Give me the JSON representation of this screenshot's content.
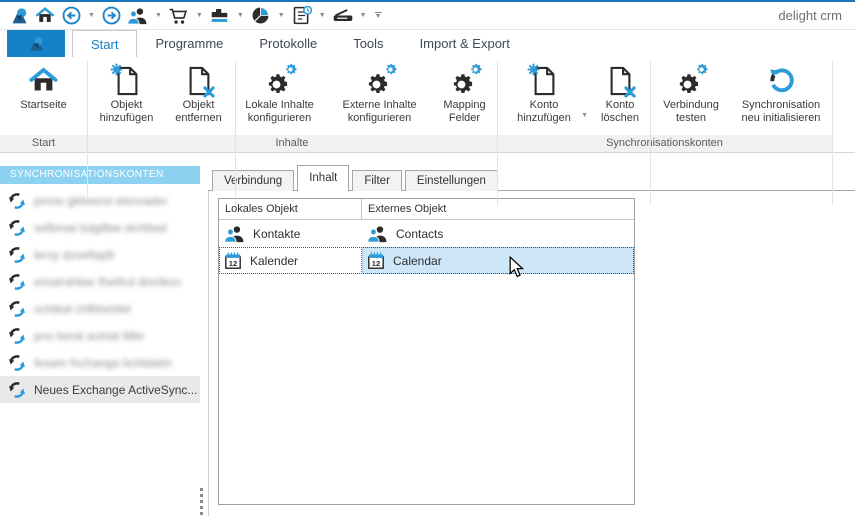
{
  "window": {
    "title": "delight crm"
  },
  "colors": {
    "accent_blue": "#1581c6",
    "icon_blue": "#2e9bd9",
    "icon_dark": "#2b2b2b",
    "titlebar_line": "#1a75bb",
    "sidebar_header_bg": "#8dd2f1",
    "selected_cell_bg": "#cde7f8",
    "selected_sidebar_bg": "#e9e9e9"
  },
  "quick_toolbar": {
    "icons": [
      {
        "name": "app-logo-icon"
      },
      {
        "name": "home-icon"
      },
      {
        "name": "back-icon",
        "dropdown": true
      },
      {
        "name": "forward-icon"
      },
      {
        "name": "contacts-icon",
        "dropdown": true
      },
      {
        "name": "cart-icon",
        "dropdown": true
      },
      {
        "name": "sales-chart-icon",
        "dropdown": true
      },
      {
        "name": "pie-chart-icon",
        "dropdown": true
      },
      {
        "name": "journal-icon",
        "dropdown": true
      },
      {
        "name": "scanner-icon",
        "dropdown": true
      },
      {
        "name": "customize-toolbar-icon"
      }
    ]
  },
  "main_tabs": {
    "items": [
      {
        "label": "Start",
        "active": true
      },
      {
        "label": "Programme",
        "active": false
      },
      {
        "label": "Protokolle",
        "active": false
      },
      {
        "label": "Tools",
        "active": false
      },
      {
        "label": "Import & Export",
        "active": false
      }
    ]
  },
  "ribbon": {
    "groups": [
      "Start",
      "Inhalte",
      "Synchronisationskonten"
    ],
    "buttons": [
      {
        "label": "Startseite",
        "icon": "home-icon",
        "group": "Start"
      },
      {
        "label": "Objekt\nhinzufügen",
        "icon": "document-add-icon",
        "group": "Inhalte"
      },
      {
        "label": "Objekt\nentfernen",
        "icon": "document-remove-icon",
        "group": "Inhalte"
      },
      {
        "label": "Lokale Inhalte\nkonfigurieren",
        "icon": "gears-icon",
        "group": "Inhalte"
      },
      {
        "label": "Externe Inhalte\nkonfigurieren",
        "icon": "gears-icon",
        "group": "Inhalte"
      },
      {
        "label": "Mapping\nFelder",
        "icon": "gears-icon",
        "group": "Inhalte"
      },
      {
        "label": "Konto\nhinzufügen",
        "icon": "document-add-icon",
        "dropdown": true,
        "group": "Synchronisationskonten"
      },
      {
        "label": "Konto\nlöschen",
        "icon": "document-remove-icon",
        "group": "Synchronisationskonten"
      },
      {
        "label": "Verbindung\ntesten",
        "icon": "gears-icon",
        "group": "Synchronisationskonten"
      },
      {
        "label": "Synchronisation\nneu initialisieren",
        "icon": "sync-refresh-icon",
        "group": "Synchronisationskonten"
      }
    ]
  },
  "sidebar": {
    "header": "SYNCHRONISATIONSKONTEN",
    "items": [
      {
        "redacted": true,
        "obscured_text": "pmne gkfwend slenvader",
        "selected": false
      },
      {
        "redacted": true,
        "obscured_text": "sefbmat bdgltbw dnrttlwd",
        "selected": false
      },
      {
        "redacted": true,
        "obscured_text": "lerxy dzseftapfi",
        "selected": false
      },
      {
        "redacted": true,
        "obscured_text": "ematrahber fhetfcd dmrtlion",
        "selected": false
      },
      {
        "redacted": true,
        "obscured_text": "schtkat chfbtsrtdel",
        "selected": false
      },
      {
        "redacted": true,
        "obscured_text": "pns beral actriat fillte",
        "selected": false
      },
      {
        "redacted": true,
        "obscured_text": "fesam fnchanga bchtdatm",
        "selected": false
      },
      {
        "redacted": false,
        "label": "Neues Exchange ActiveSync...",
        "selected": true
      }
    ]
  },
  "panel": {
    "tabs": [
      {
        "label": "Verbindung",
        "active": false
      },
      {
        "label": "Inhalt",
        "active": true
      },
      {
        "label": "Filter",
        "active": false
      },
      {
        "label": "Einstellungen",
        "active": false
      }
    ],
    "table": {
      "columns": [
        "Lokales Objekt",
        "Externes Objekt"
      ],
      "rows": [
        {
          "local": {
            "icon": "contacts-icon",
            "label": "Kontakte"
          },
          "external": {
            "icon": "contacts-icon",
            "label": "Contacts"
          },
          "selected": false
        },
        {
          "local": {
            "icon": "calendar-icon",
            "label": "Kalender"
          },
          "external": {
            "icon": "calendar-icon",
            "label": "Calendar"
          },
          "selected": true
        }
      ]
    }
  }
}
